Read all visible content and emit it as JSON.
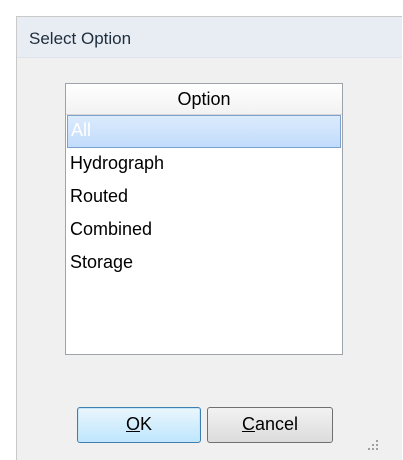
{
  "window": {
    "title": "Select Option"
  },
  "list": {
    "header": "Option",
    "items": [
      {
        "label": "All",
        "selected": true
      },
      {
        "label": "Hydrograph",
        "selected": false
      },
      {
        "label": "Routed",
        "selected": false
      },
      {
        "label": "Combined",
        "selected": false
      },
      {
        "label": "Storage",
        "selected": false
      }
    ]
  },
  "buttons": {
    "ok": {
      "accel": "O",
      "rest": "K"
    },
    "cancel": {
      "accel": "C",
      "rest": "ancel"
    }
  },
  "colors": {
    "selection_bg": "#c9e0fb",
    "selection_border": "#7da2ce",
    "window_bg": "#f0f0f0",
    "titlebar_bg": "#e8edf3"
  },
  "icons": {
    "resize_grip": "resize-grip-icon"
  }
}
